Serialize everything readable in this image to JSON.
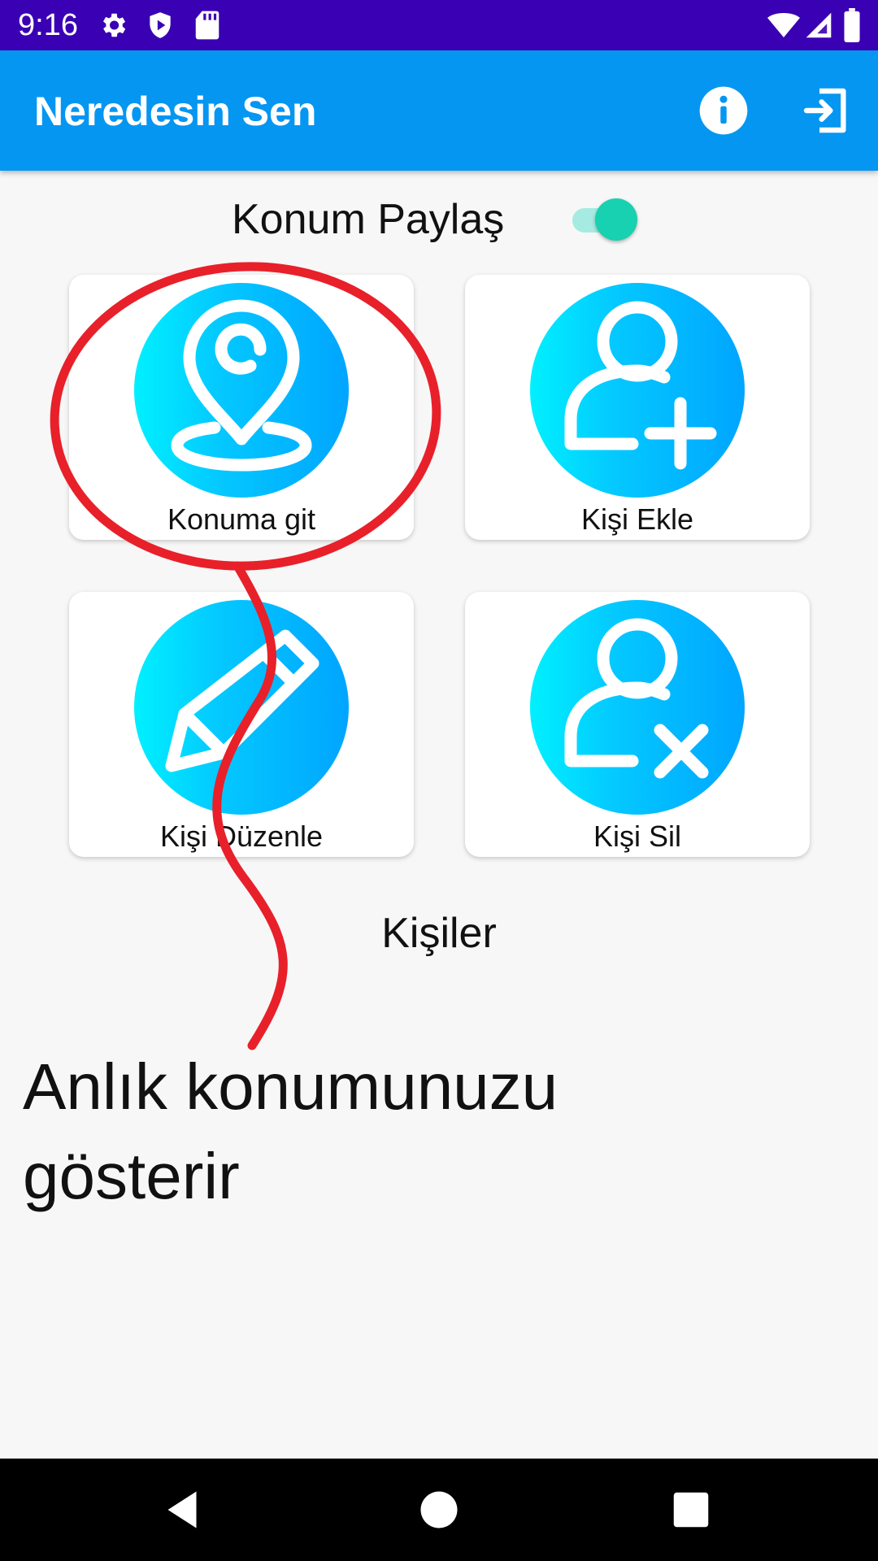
{
  "status_bar": {
    "time": "9:16",
    "icons": [
      "settings-icon",
      "play-protect-icon",
      "sd-card-icon",
      "wifi-icon",
      "signal-icon",
      "battery-icon"
    ]
  },
  "app_bar": {
    "title": "Neredesin Sen",
    "actions": [
      "info-icon",
      "exit-icon"
    ]
  },
  "location_share": {
    "label": "Konum Paylaş",
    "enabled": true
  },
  "menu_cards": [
    {
      "label": "Konuma git",
      "icon": "location-pin-icon"
    },
    {
      "label": "Kişi Ekle",
      "icon": "add-person-icon"
    },
    {
      "label": "Kişi Düzenle",
      "icon": "pencil-icon"
    },
    {
      "label": "Kişi Sil",
      "icon": "remove-person-icon"
    }
  ],
  "contacts_label": "Kişiler",
  "annotation": {
    "text_line1": "Anlık konumunuzu",
    "text_line2": "gösterir"
  },
  "nav_bar": {
    "buttons": [
      "back-icon",
      "home-icon",
      "recents-icon"
    ]
  },
  "colors": {
    "status_bar": "#3a00b3",
    "app_bar": "#0596f2",
    "toggle_on": "#17d1b0",
    "annotation": "#e8202a"
  }
}
